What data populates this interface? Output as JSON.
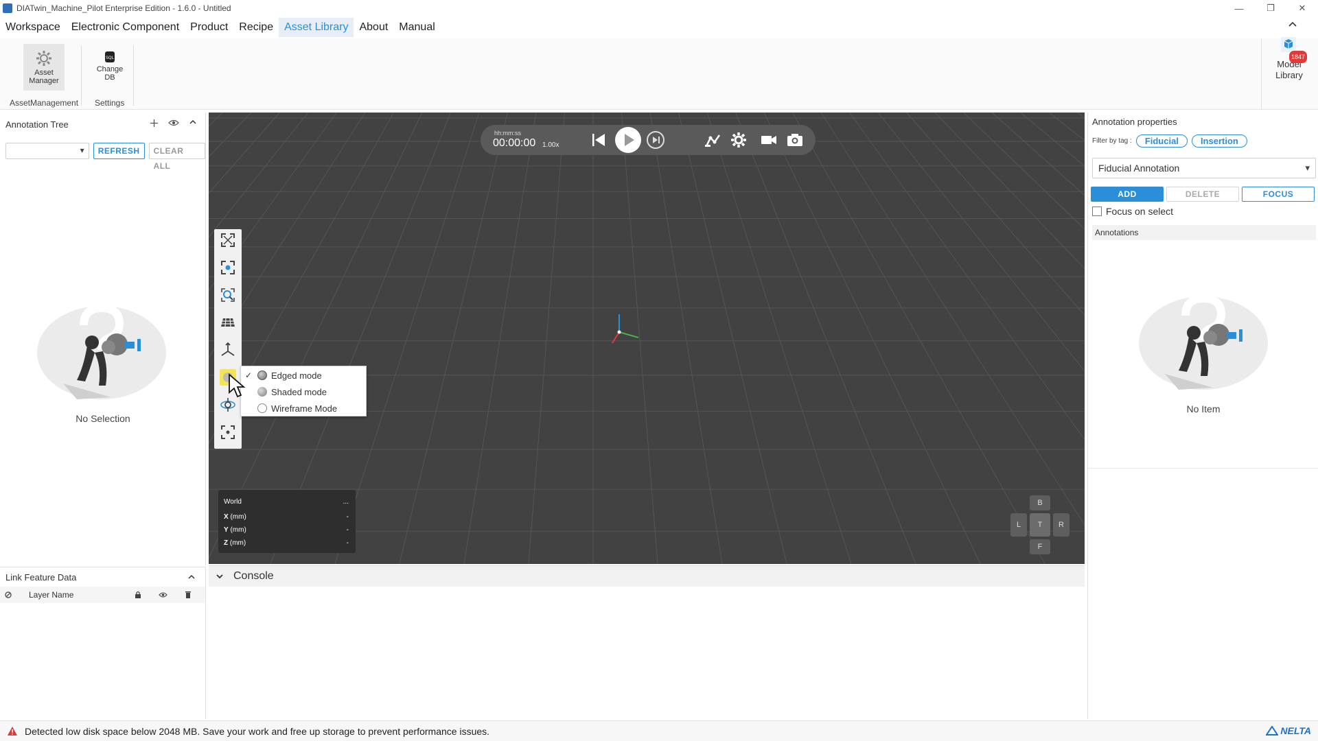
{
  "window": {
    "title": "DIATwin_Machine_Pilot Enterprise Edition - 1.6.0 - Untitled",
    "minimize": "—",
    "maximize": "❐",
    "close": "✕"
  },
  "menubar": {
    "items": [
      {
        "label": "Workspace"
      },
      {
        "label": "Electronic Component"
      },
      {
        "label": "Product"
      },
      {
        "label": "Recipe"
      },
      {
        "label": "Asset Library",
        "active": true
      },
      {
        "label": "About"
      },
      {
        "label": "Manual"
      }
    ],
    "collapse_icon": "chevron-up-icon"
  },
  "ribbon": {
    "asset_manager_label": "Asset Manager",
    "change_db_label": "Change DB",
    "group_asset_management": "AssetManagement",
    "group_settings": "Settings",
    "model_library_label": "Model Library",
    "model_library_badge": "1847"
  },
  "annotation_tree": {
    "title": "Annotation Tree",
    "refresh_label": "REFRESH",
    "clear_all_label": "CLEAR ALL",
    "empty_text": "No Selection"
  },
  "link_feature_data": {
    "title": "Link Feature Data",
    "column_layer_name": "Layer Name"
  },
  "viewport": {
    "playback": {
      "time_format_label": "hh:mm:ss",
      "time": "00:00:00",
      "speed": "1.00x"
    },
    "display_mode_menu": {
      "items": [
        {
          "label": "Edged mode",
          "checked": true,
          "ball_color": "#7a7a7a"
        },
        {
          "label": "Shaded mode",
          "checked": false,
          "ball_color": "#8a8a8a"
        },
        {
          "label": "Wireframe Mode",
          "checked": false,
          "ball_color": "#ffffff"
        }
      ]
    },
    "coordinates": {
      "frame": "World",
      "more": "...",
      "rows": [
        {
          "axis": "X",
          "unit": "(mm)",
          "value": "-"
        },
        {
          "axis": "Y",
          "unit": "(mm)",
          "value": "-"
        },
        {
          "axis": "Z",
          "unit": "(mm)",
          "value": "-"
        }
      ]
    },
    "view_cube": {
      "top": "T",
      "back": "B",
      "front": "F",
      "left": "L",
      "right": "R"
    }
  },
  "console": {
    "title": "Console"
  },
  "annotation_properties": {
    "title": "Annotation properties",
    "filter_label": "Filter by tag :",
    "tags": [
      "Fiducial",
      "Insertion"
    ],
    "selected_type": "Fiducial Annotation",
    "add_label": "ADD",
    "delete_label": "DELETE",
    "focus_label": "FOCUS",
    "focus_on_select_label": "Focus on select",
    "annotations_header": "Annotations",
    "empty_text": "No Item"
  },
  "status_bar": {
    "message": "Detected low disk space below 2048 MB. Save your work and free up storage to prevent performance issues.",
    "brand": "NELTA"
  },
  "colors": {
    "accent": "#2a8fd8",
    "viewport_bg": "#424242",
    "warning": "#d93b3b",
    "badge": "#e03a3a"
  }
}
